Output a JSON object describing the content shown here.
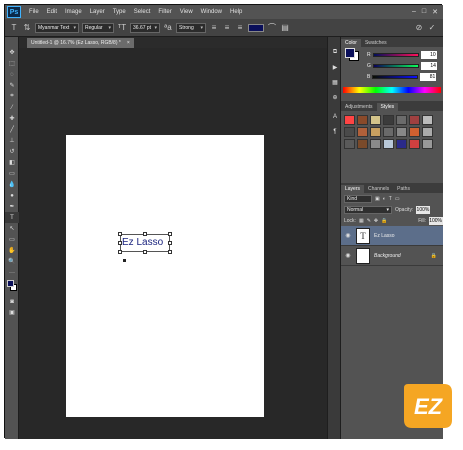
{
  "menubar": {
    "logo": "Ps",
    "items": [
      "File",
      "Edit",
      "Image",
      "Layer",
      "Type",
      "Select",
      "Filter",
      "View",
      "Window",
      "Help"
    ],
    "window_controls": [
      "–",
      "□",
      "✕"
    ]
  },
  "options": {
    "font_family": "Myanmar Text",
    "font_style": "Regular",
    "font_size": "36.67 pt",
    "anti_alias": "Strong",
    "text_color": "#0a0f5a"
  },
  "document": {
    "tab_title": "Untitled-1 @ 16.7% (Ez Lasso, RGB/8) *",
    "tab_close": "×",
    "text_content": "Ez Lasso"
  },
  "color_panel": {
    "tabs": [
      "Color",
      "Swatches"
    ],
    "foreground_color": "#0a0f5a",
    "rows": [
      {
        "channel": "R",
        "value": "10"
      },
      {
        "channel": "G",
        "value": "14"
      },
      {
        "channel": "B",
        "value": "81"
      }
    ]
  },
  "adjustments_panel": {
    "tabs": [
      "Adjustments",
      "Styles"
    ],
    "style_colors": [
      "#ff4444",
      "#8a4a2a",
      "#d4c48a",
      "#3b3b3b",
      "#6b6b6b",
      "#a04040",
      "#bbbbbb",
      "#4a4a4a",
      "#b0603a",
      "#c8a060",
      "#6a6a6a",
      "#888888",
      "#d06030",
      "#aaaaaa",
      "#5a5a5a",
      "#7a4a2a",
      "#8a8a8a",
      "#b8c8d8",
      "#2a2a8a",
      "#d04040",
      "#999999"
    ]
  },
  "layers_panel": {
    "tabs": [
      "Layers",
      "Channels",
      "Paths"
    ],
    "kind_label": "Kind",
    "blend_mode": "Normal",
    "opacity_label": "Opacity:",
    "opacity_value": "100%",
    "lock_label": "Lock:",
    "fill_label": "Fill:",
    "fill_value": "100%",
    "layers": [
      {
        "name": "Ez Lasso",
        "thumb": "T"
      },
      {
        "name": "Background",
        "thumb": ""
      }
    ]
  },
  "watermark": {
    "text": "EZ",
    "color": "#f5a623"
  }
}
